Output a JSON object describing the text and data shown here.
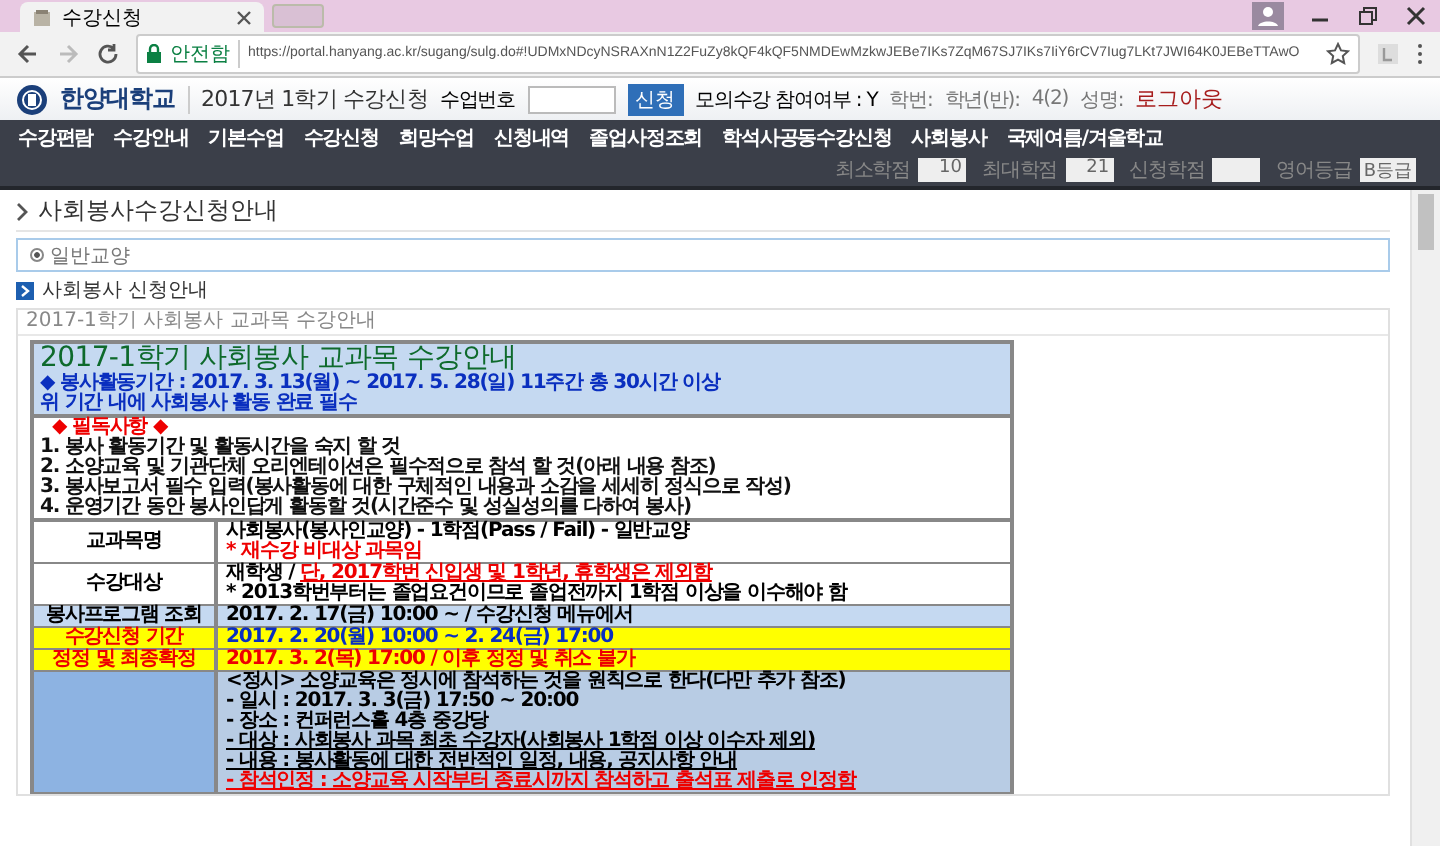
{
  "browser": {
    "tab_title": "수강신청",
    "security": "안전함",
    "url": "https://portal.hanyang.ac.kr/sugang/sulg.do#!UDMxNDcyNSRAXnN1Z2FuZy8kQF4kQF5NMDEwMzkwJEBe7IKs7ZqM67SJ7IKs7IiY6rCV7Iug7LKt7JWI64K0JEBeTTAwO"
  },
  "header": {
    "logo": "한양대학교",
    "title": "2017년 1학기 수강신청",
    "course_no_label": "수업번호",
    "apply_button": "신청",
    "mock_status": "모의수강 참여여부 : Y",
    "student_id_label": "학번:",
    "grade_label": "학년(반):",
    "grade": "4(2)",
    "name_label": "성명:",
    "logout": "로그아웃"
  },
  "nav": [
    "수강편람",
    "수강안내",
    "기본수업",
    "수강신청",
    "희망수업",
    "신청내역",
    "졸업사정조회",
    "학석사공동수강신청",
    "사회봉사",
    "국제여름/겨울학교"
  ],
  "credits": [
    {
      "label": "최소학점",
      "value": "10"
    },
    {
      "label": "최대학점",
      "value": "21"
    },
    {
      "label": "신청학점"
    },
    {
      "label": "영어등급",
      "value": "B등급"
    }
  ],
  "page": {
    "title": "사회봉사수강신청안내",
    "options": [
      {
        "label": "일반교양",
        "selected": true
      }
    ],
    "section": "사회봉사 신청안내",
    "subtitle": "2017-1학기 사회봉사 교과목 수강안내"
  },
  "notice": {
    "title": "2017-1학기 사회봉사 교과목 수강안내",
    "title_lines": [
      "◆ 봉사활동기간 : 2017. 3. 13(월) ~ 2017. 5. 28(일)  11주간 총 30시간 이상",
      "위 기간 내에 사회봉사 활동 완료 필수"
    ],
    "must_read": {
      "heading": "◆ 필독사항 ◆",
      "items": [
        "1. 봉사 활동기간 및 활동시간을 숙지 할 것",
        "2. 소양교육 및 기관단체 오리엔테이션은 필수적으로 참석 할 것(아래 내용 참조)",
        "3. 봉사보고서 필수 입력(봉사활동에 대한 구체적인 내용과 소감을 세세히 정식으로 작성)",
        "4. 운영기간 동안 봉사인답게 활동할 것(시간준수 및 성실성의를 다하여 봉사)"
      ]
    },
    "rows": [
      {
        "kind": "plain",
        "label": "교과목명",
        "lines": [
          [
            {
              "text": "사회봉사(봉사인교양) - 1학점(Pass / Fail) - 일반교양",
              "kind": "plain"
            }
          ],
          [
            {
              "text": "* 재수강 비대상 과목임",
              "kind": "red"
            }
          ]
        ]
      },
      {
        "kind": "plain",
        "label": "수강대상",
        "lines": [
          [
            {
              "text": "재학생 / ",
              "kind": "plain"
            },
            {
              "text": "단, 2017학번 신입생 및 1학년, 휴학생은 제외함",
              "kind": "alert"
            }
          ],
          [
            {
              "text": "* 2013학번부터는 졸업요건이므로 졸업전까지 1학점 이상을 이수해야 함",
              "kind": "plain"
            }
          ]
        ]
      },
      {
        "kind": "light",
        "label": "봉사프로그램 조회",
        "lines": [
          [
            {
              "text": "2017. 2. 17(금) 10:00 ~ / 수강신청 메뉴에서",
              "kind": "plain"
            }
          ]
        ]
      },
      {
        "kind": "highlight",
        "label": "수강신청 기간",
        "lines": [
          [
            {
              "text": "2017. 2. 20(월) 10:00 ~ 2. 24(금) 17:00",
              "kind": "blue"
            }
          ]
        ]
      },
      {
        "kind": "highlight",
        "label": "정정 및 최종확정",
        "lines": [
          [
            {
              "text": "2017. 3. 2(목) 17:00 / 이후 정정 및 취소 불가",
              "kind": "red"
            }
          ]
        ]
      },
      {
        "kind": "blue",
        "lines": [
          [
            {
              "text": "<정시> 소양교육은 정시에 참석하는 것을 원칙으로 한다(다만 추가 참조)",
              "kind": "plain"
            }
          ],
          [
            {
              "text": "- 일시 : 2017. 3. 3(금)  17:50 ~ 20:00",
              "kind": "plain"
            }
          ],
          [
            {
              "text": "- 장소 : 컨퍼런스홀 4층 중강당",
              "kind": "plain"
            }
          ],
          [
            {
              "text": "- 대상 : 사회봉사 과목 최초 수강자(사회봉사 1학점 이상 이수자 제외)",
              "kind": "underline"
            }
          ],
          [
            {
              "text": "- 내용 : 봉사활동에 대한 전반적인 일정, 내용, 공지사항 안내",
              "kind": "underline"
            }
          ],
          [
            {
              "text": "- 참석인정 : 소양교육 시작부터 종료시까지 참석하고 출석표 제출로 인정함",
              "kind": "alert"
            }
          ]
        ]
      }
    ]
  }
}
